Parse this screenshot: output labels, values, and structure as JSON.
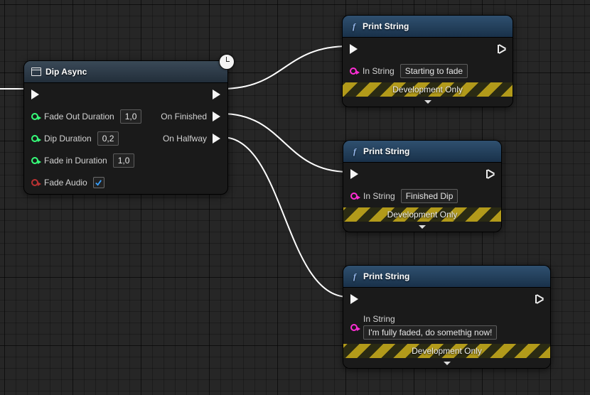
{
  "dipNode": {
    "title": "Dip Async",
    "inputs": {
      "fadeOutDuration": {
        "label": "Fade Out Duration",
        "value": "1,0"
      },
      "dipDuration": {
        "label": "Dip Duration",
        "value": "0,2"
      },
      "fadeInDuration": {
        "label": "Fade in Duration",
        "value": "1,0"
      },
      "fadeAudio": {
        "label": "Fade Audio",
        "checked": true
      }
    },
    "outputs": {
      "default": "",
      "onFinished": "On Finished",
      "onHalfway": "On Halfway"
    }
  },
  "printNodes": {
    "title": "Print String",
    "inStringLabel": "In String",
    "developmentOnly": "Development Only",
    "top": {
      "value": "Starting to fade"
    },
    "mid": {
      "value": "Finished Dip"
    },
    "bottom": {
      "value": "I'm fully faded, do somethig now!"
    }
  }
}
